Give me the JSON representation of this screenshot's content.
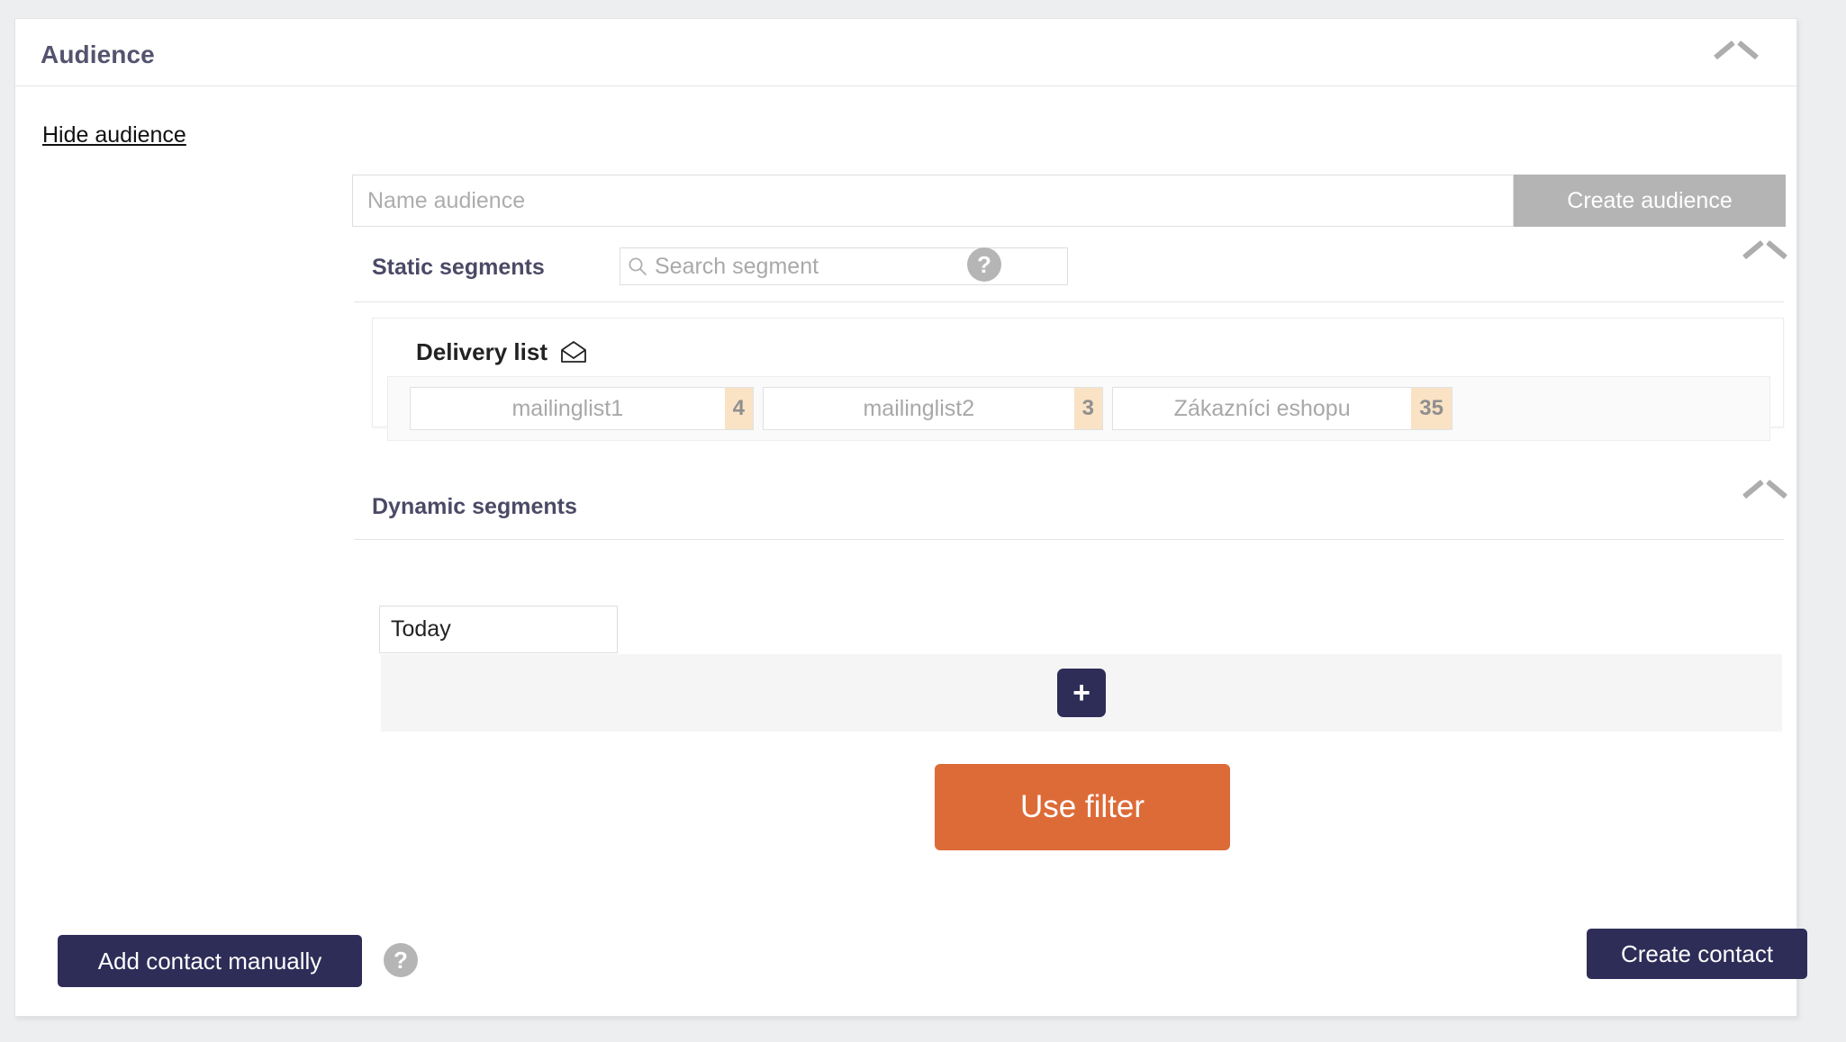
{
  "card": {
    "title": "Audience",
    "collapse_icon": "chevron-up-icon",
    "hide_audience_link": "Hide audience"
  },
  "audience_form": {
    "name_value": "",
    "name_placeholder": "Name audience",
    "create_button": "Create audience"
  },
  "static_segments": {
    "label": "Static segments",
    "search_value": "",
    "search_placeholder": "Search segment",
    "search_icon": "search-icon",
    "help_icon": "question-mark-icon",
    "collapse_icon": "chevron-up-icon",
    "delivery_list": {
      "title": "Delivery list",
      "icon": "open-envelope-icon",
      "chips": [
        {
          "label": "mailinglist1",
          "count": "4"
        },
        {
          "label": "mailinglist2",
          "count": "3"
        },
        {
          "label": "Zákazníci eshopu",
          "count": "35"
        }
      ]
    }
  },
  "dynamic_segments": {
    "label": "Dynamic segments",
    "collapse_icon": "chevron-up-icon",
    "today_value": "Today",
    "add_filter_icon": "plus-icon",
    "use_filter_button": "Use filter"
  },
  "footer": {
    "add_contact_button": "Add contact manually",
    "help_icon": "question-mark-icon",
    "create_contact_button": "Create contact"
  },
  "colors": {
    "brand_navy": "#2e2d58",
    "accent_orange": "#dd6b38",
    "badge_peach": "#fae2c4",
    "heading_purple": "#54536f",
    "disabled_gray": "#b4b4b4",
    "page_bg": "#eceef0"
  }
}
